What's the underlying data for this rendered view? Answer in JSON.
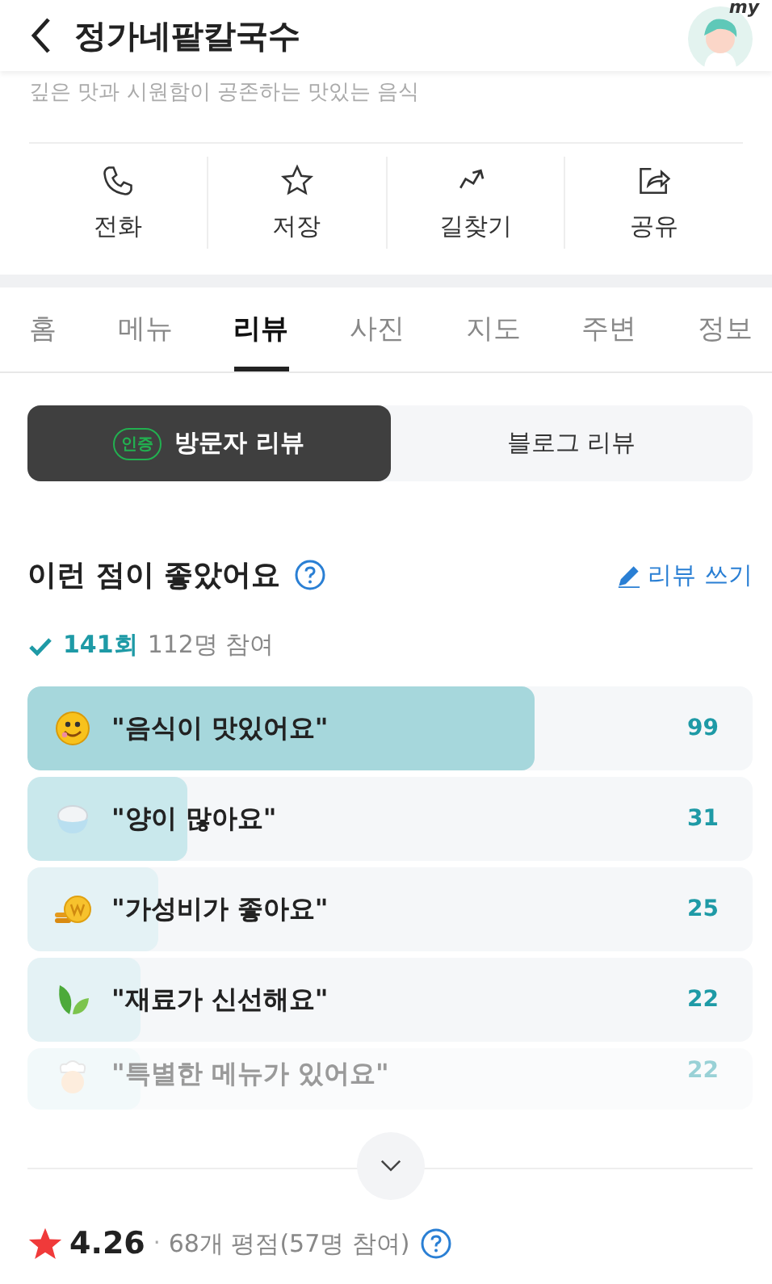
{
  "header": {
    "title": "정가네팥칼국수",
    "avatar_badge": "my"
  },
  "subtitle": "깊은 맛과 시원함이 공존하는 맛있는 음식",
  "actions": [
    {
      "kind": "phone",
      "label": "전화"
    },
    {
      "kind": "star",
      "label": "저장"
    },
    {
      "kind": "route",
      "label": "길찾기"
    },
    {
      "kind": "share",
      "label": "공유"
    }
  ],
  "tabs": [
    {
      "label": "홈",
      "selected": false
    },
    {
      "label": "메뉴",
      "selected": false
    },
    {
      "label": "리뷰",
      "selected": true
    },
    {
      "label": "사진",
      "selected": false
    },
    {
      "label": "지도",
      "selected": false
    },
    {
      "label": "주변",
      "selected": false
    },
    {
      "label": "정보",
      "selected": false
    }
  ],
  "review_types": [
    {
      "label": "방문자 리뷰",
      "badge": "인증",
      "selected": true
    },
    {
      "label": "블로그 리뷰",
      "selected": false
    }
  ],
  "section": {
    "title": "이런 점이 좋았어요",
    "write_link": "리뷰 쓰기",
    "count_bold": "141회",
    "count_rest": "112명 참여"
  },
  "keywords": [
    {
      "kind": "smile",
      "label": "\"음식이 맛있어요\"",
      "count": "99",
      "level": 0.7,
      "faded": false
    },
    {
      "kind": "rice",
      "label": "\"양이 많아요\"",
      "count": "31",
      "level": 0.22,
      "faded": false
    },
    {
      "kind": "coin",
      "label": "\"가성비가 좋아요\"",
      "count": "25",
      "level": 0.18,
      "faded": false
    },
    {
      "kind": "leaf",
      "label": "\"재료가 신선해요\"",
      "count": "22",
      "level": 0.155,
      "faded": false
    },
    {
      "kind": "chef",
      "label": "\"특별한 메뉴가 있어요\"",
      "count": "22",
      "level": 0.155,
      "faded": true
    }
  ],
  "rating": {
    "score": "4.26",
    "separator": "·",
    "detail": "68개 평점(57명 참여)"
  }
}
